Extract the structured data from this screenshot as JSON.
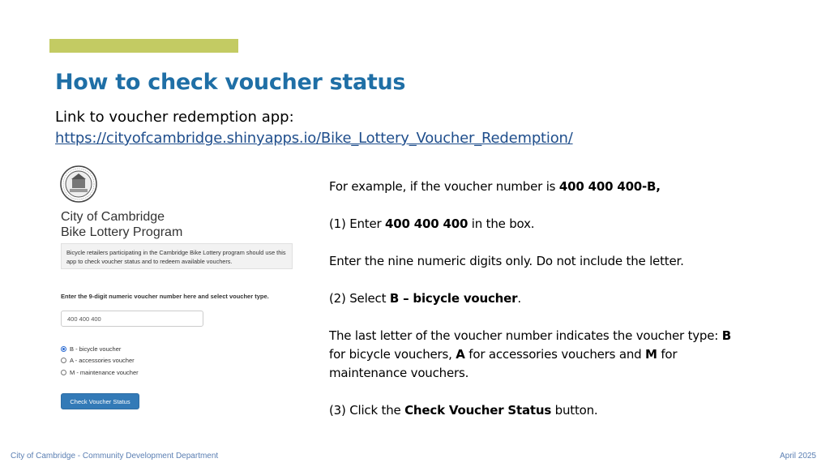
{
  "slide": {
    "title": "How to check voucher status",
    "link_intro": "Link to voucher redemption app:",
    "link_url": "https://cityofcambridge.shinyapps.io/Bike_Lottery_Voucher_Redemption/"
  },
  "app": {
    "title_line1": "City of Cambridge",
    "title_line2": "Bike Lottery Program",
    "info_text": "Bicycle retailers participating in the Cambridge Bike Lottery program should use this app to check voucher status and to redeem available vouchers.",
    "prompt_label": "Enter the 9-digit numeric voucher number here and select voucher type.",
    "input_value": "400 400 400",
    "radio_options": [
      {
        "label": "B - bicycle voucher",
        "checked": true
      },
      {
        "label": "A - accessories voucher",
        "checked": false
      },
      {
        "label": "M - maintenance voucher",
        "checked": false
      }
    ],
    "button_label": "Check Voucher Status"
  },
  "instructions": {
    "p1_pre": "For example, if the voucher number is ",
    "p1_bold": "400 400 400-B,",
    "p2_pre": "(1) Enter ",
    "p2_bold": "400 400 400",
    "p2_post": " in the box.",
    "p3": "Enter the nine numeric digits only. Do not include the letter.",
    "p4_pre": "(2) Select ",
    "p4_bold": "B – bicycle voucher",
    "p4_post": ".",
    "p5_pre": "The last letter of the voucher number indicates the voucher type: ",
    "p5_b1": "B",
    "p5_mid1": " for bicycle vouchers, ",
    "p5_b2": "A",
    "p5_mid2": " for accessories vouchers and ",
    "p5_b3": "M",
    "p5_post": " for maintenance vouchers.",
    "p6_pre": "(3) Click the ",
    "p6_bold": "Check Voucher Status",
    "p6_post": " button."
  },
  "footer": {
    "left": "City of Cambridge - Community Development Department",
    "right": "April 2025"
  },
  "colors": {
    "accent_bar": "#c3cb63",
    "title": "#1f6fa6",
    "link": "#1f4e8c",
    "button": "#337ab7",
    "footer": "#5b7fb3"
  }
}
